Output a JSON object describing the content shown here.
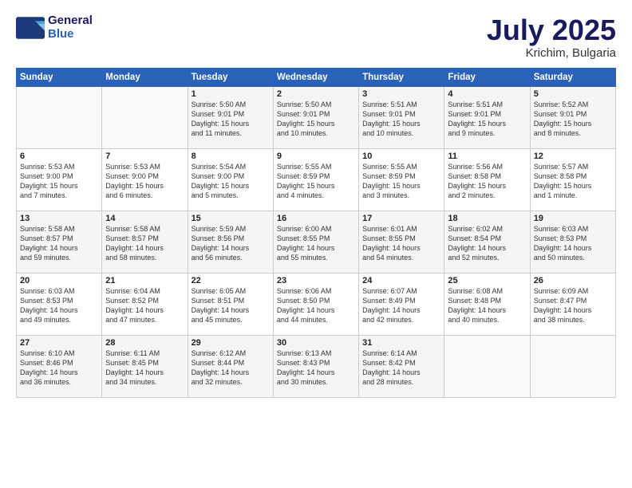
{
  "header": {
    "logo_line1": "General",
    "logo_line2": "Blue",
    "title": "July 2025",
    "subtitle": "Krichim, Bulgaria"
  },
  "days_of_week": [
    "Sunday",
    "Monday",
    "Tuesday",
    "Wednesday",
    "Thursday",
    "Friday",
    "Saturday"
  ],
  "weeks": [
    [
      {
        "day": "",
        "info": ""
      },
      {
        "day": "",
        "info": ""
      },
      {
        "day": "1",
        "info": "Sunrise: 5:50 AM\nSunset: 9:01 PM\nDaylight: 15 hours\nand 11 minutes."
      },
      {
        "day": "2",
        "info": "Sunrise: 5:50 AM\nSunset: 9:01 PM\nDaylight: 15 hours\nand 10 minutes."
      },
      {
        "day": "3",
        "info": "Sunrise: 5:51 AM\nSunset: 9:01 PM\nDaylight: 15 hours\nand 10 minutes."
      },
      {
        "day": "4",
        "info": "Sunrise: 5:51 AM\nSunset: 9:01 PM\nDaylight: 15 hours\nand 9 minutes."
      },
      {
        "day": "5",
        "info": "Sunrise: 5:52 AM\nSunset: 9:01 PM\nDaylight: 15 hours\nand 8 minutes."
      }
    ],
    [
      {
        "day": "6",
        "info": "Sunrise: 5:53 AM\nSunset: 9:00 PM\nDaylight: 15 hours\nand 7 minutes."
      },
      {
        "day": "7",
        "info": "Sunrise: 5:53 AM\nSunset: 9:00 PM\nDaylight: 15 hours\nand 6 minutes."
      },
      {
        "day": "8",
        "info": "Sunrise: 5:54 AM\nSunset: 9:00 PM\nDaylight: 15 hours\nand 5 minutes."
      },
      {
        "day": "9",
        "info": "Sunrise: 5:55 AM\nSunset: 8:59 PM\nDaylight: 15 hours\nand 4 minutes."
      },
      {
        "day": "10",
        "info": "Sunrise: 5:55 AM\nSunset: 8:59 PM\nDaylight: 15 hours\nand 3 minutes."
      },
      {
        "day": "11",
        "info": "Sunrise: 5:56 AM\nSunset: 8:58 PM\nDaylight: 15 hours\nand 2 minutes."
      },
      {
        "day": "12",
        "info": "Sunrise: 5:57 AM\nSunset: 8:58 PM\nDaylight: 15 hours\nand 1 minute."
      }
    ],
    [
      {
        "day": "13",
        "info": "Sunrise: 5:58 AM\nSunset: 8:57 PM\nDaylight: 14 hours\nand 59 minutes."
      },
      {
        "day": "14",
        "info": "Sunrise: 5:58 AM\nSunset: 8:57 PM\nDaylight: 14 hours\nand 58 minutes."
      },
      {
        "day": "15",
        "info": "Sunrise: 5:59 AM\nSunset: 8:56 PM\nDaylight: 14 hours\nand 56 minutes."
      },
      {
        "day": "16",
        "info": "Sunrise: 6:00 AM\nSunset: 8:55 PM\nDaylight: 14 hours\nand 55 minutes."
      },
      {
        "day": "17",
        "info": "Sunrise: 6:01 AM\nSunset: 8:55 PM\nDaylight: 14 hours\nand 54 minutes."
      },
      {
        "day": "18",
        "info": "Sunrise: 6:02 AM\nSunset: 8:54 PM\nDaylight: 14 hours\nand 52 minutes."
      },
      {
        "day": "19",
        "info": "Sunrise: 6:03 AM\nSunset: 8:53 PM\nDaylight: 14 hours\nand 50 minutes."
      }
    ],
    [
      {
        "day": "20",
        "info": "Sunrise: 6:03 AM\nSunset: 8:53 PM\nDaylight: 14 hours\nand 49 minutes."
      },
      {
        "day": "21",
        "info": "Sunrise: 6:04 AM\nSunset: 8:52 PM\nDaylight: 14 hours\nand 47 minutes."
      },
      {
        "day": "22",
        "info": "Sunrise: 6:05 AM\nSunset: 8:51 PM\nDaylight: 14 hours\nand 45 minutes."
      },
      {
        "day": "23",
        "info": "Sunrise: 6:06 AM\nSunset: 8:50 PM\nDaylight: 14 hours\nand 44 minutes."
      },
      {
        "day": "24",
        "info": "Sunrise: 6:07 AM\nSunset: 8:49 PM\nDaylight: 14 hours\nand 42 minutes."
      },
      {
        "day": "25",
        "info": "Sunrise: 6:08 AM\nSunset: 8:48 PM\nDaylight: 14 hours\nand 40 minutes."
      },
      {
        "day": "26",
        "info": "Sunrise: 6:09 AM\nSunset: 8:47 PM\nDaylight: 14 hours\nand 38 minutes."
      }
    ],
    [
      {
        "day": "27",
        "info": "Sunrise: 6:10 AM\nSunset: 8:46 PM\nDaylight: 14 hours\nand 36 minutes."
      },
      {
        "day": "28",
        "info": "Sunrise: 6:11 AM\nSunset: 8:45 PM\nDaylight: 14 hours\nand 34 minutes."
      },
      {
        "day": "29",
        "info": "Sunrise: 6:12 AM\nSunset: 8:44 PM\nDaylight: 14 hours\nand 32 minutes."
      },
      {
        "day": "30",
        "info": "Sunrise: 6:13 AM\nSunset: 8:43 PM\nDaylight: 14 hours\nand 30 minutes."
      },
      {
        "day": "31",
        "info": "Sunrise: 6:14 AM\nSunset: 8:42 PM\nDaylight: 14 hours\nand 28 minutes."
      },
      {
        "day": "",
        "info": ""
      },
      {
        "day": "",
        "info": ""
      }
    ]
  ]
}
